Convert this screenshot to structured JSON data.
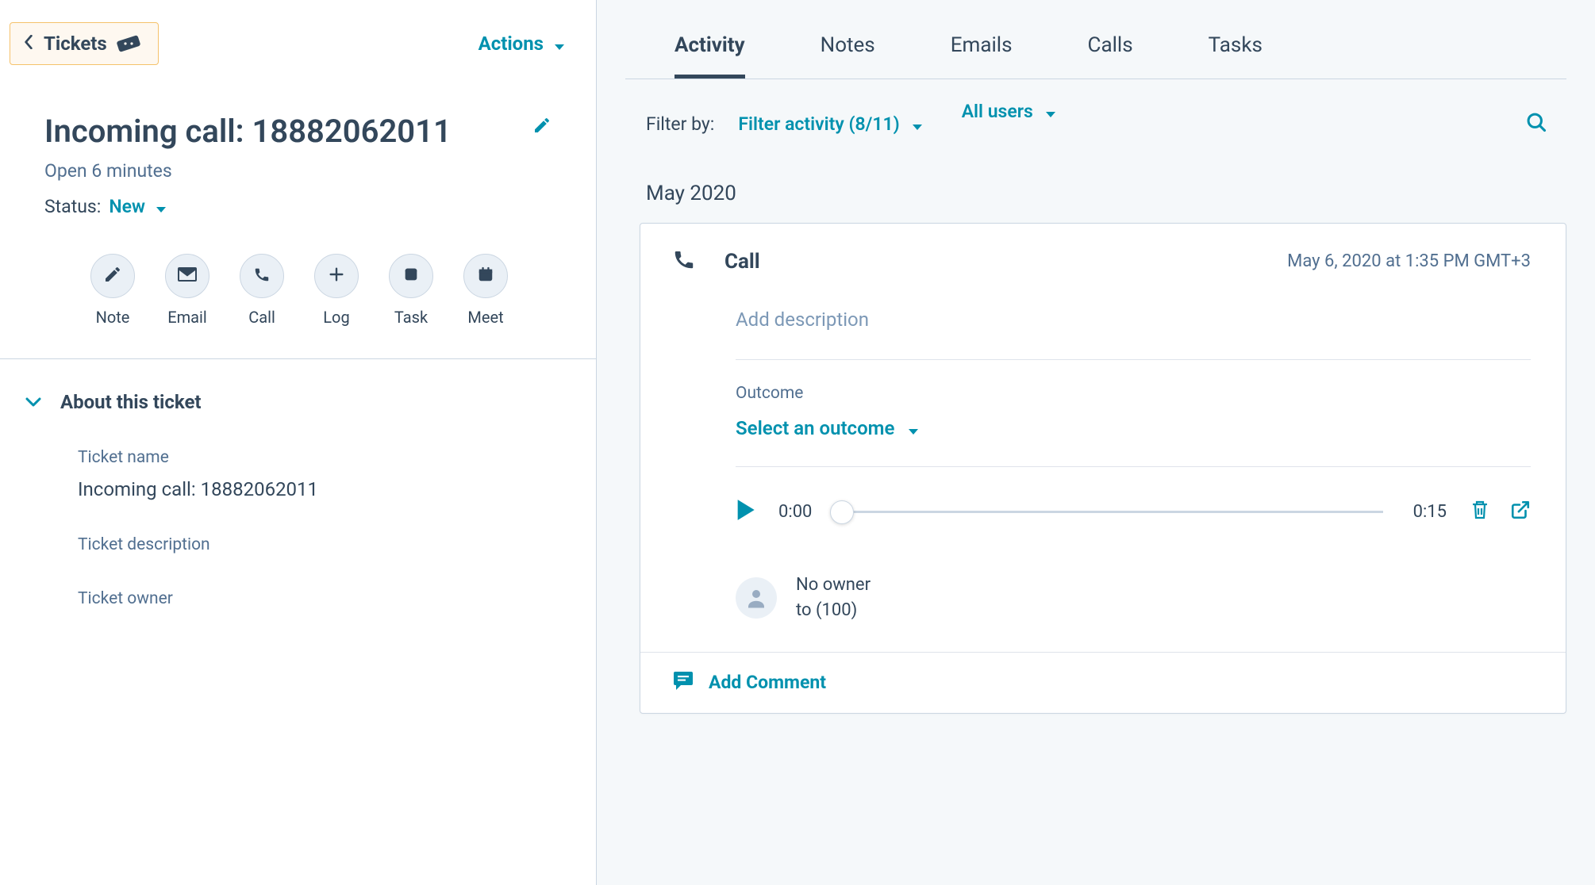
{
  "sidebar": {
    "back_label": "Tickets",
    "actions_label": "Actions",
    "title": "Incoming call: 18882062011",
    "open_line": "Open 6 minutes",
    "status_label": "Status:",
    "status_value": "New",
    "quick_actions": [
      {
        "id": "note",
        "label": "Note"
      },
      {
        "id": "email",
        "label": "Email"
      },
      {
        "id": "call",
        "label": "Call"
      },
      {
        "id": "log",
        "label": "Log"
      },
      {
        "id": "task",
        "label": "Task"
      },
      {
        "id": "meet",
        "label": "Meet"
      }
    ],
    "about_header": "About this ticket",
    "fields": {
      "name_label": "Ticket name",
      "name_value": "Incoming call: 18882062011",
      "desc_label": "Ticket description",
      "owner_label": "Ticket owner"
    }
  },
  "main": {
    "tabs": [
      "Activity",
      "Notes",
      "Emails",
      "Calls",
      "Tasks"
    ],
    "active_tab": 0,
    "filter": {
      "label": "Filter by:",
      "activity_link": "Filter activity (8/11)",
      "users_link": "All users"
    },
    "month_header": "May 2020",
    "call_card": {
      "title": "Call",
      "timestamp": "May 6, 2020 at 1:35 PM GMT+3",
      "desc_placeholder": "Add description",
      "outcome_label": "Outcome",
      "outcome_select": "Select an outcome",
      "player": {
        "cur": "0:00",
        "dur": "0:15"
      },
      "owner_line1": "No owner",
      "owner_line2": "to (100)",
      "add_comment": "Add Comment"
    }
  },
  "colors": {
    "teal": "#0091ae",
    "slate": "#33475b"
  }
}
